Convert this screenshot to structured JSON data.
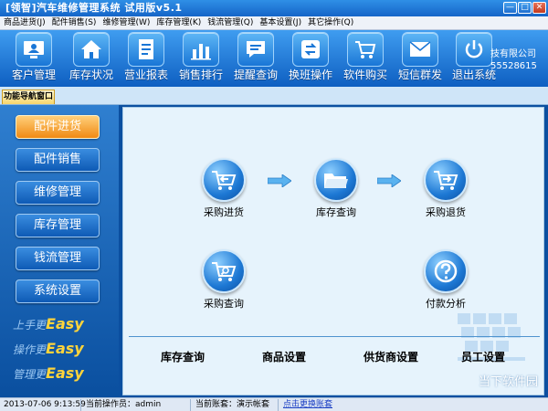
{
  "window": {
    "title": "[领智]汽车维修管理系统 试用版v5.1",
    "controls": [
      "minimize-icon",
      "maximize-icon",
      "close-icon"
    ]
  },
  "menu": [
    "商品进货(J)",
    "配件销售(S)",
    "维修管理(W)",
    "库存管理(K)",
    "钱流管理(Q)",
    "基本设置(J)",
    "其它操作(Q)"
  ],
  "toolbar": {
    "items": [
      {
        "label": "客户管理",
        "icon": "customer-icon"
      },
      {
        "label": "库存状况",
        "icon": "home-icon"
      },
      {
        "label": "营业报表",
        "icon": "report-icon"
      },
      {
        "label": "销售排行",
        "icon": "bar-chart-icon"
      },
      {
        "label": "提醒查询",
        "icon": "message-icon"
      },
      {
        "label": "换班操作",
        "icon": "shift-icon"
      },
      {
        "label": "软件购买",
        "icon": "cart-icon"
      },
      {
        "label": "短信群发",
        "icon": "mail-icon"
      },
      {
        "label": "退出系统",
        "icon": "power-icon"
      }
    ],
    "company_line1": "技有限公司",
    "company_line2": "55528615"
  },
  "nav": {
    "tab": "功能导航窗口",
    "items": [
      "配件进货",
      "配件销售",
      "维修管理",
      "库存管理",
      "钱流管理",
      "系统设置"
    ],
    "active_index": 0,
    "slogans": [
      {
        "prefix": "上手更",
        "word": "Easy"
      },
      {
        "prefix": "操作更",
        "word": "Easy"
      },
      {
        "prefix": "管理更",
        "word": "Easy"
      }
    ]
  },
  "main": {
    "actions": [
      {
        "label": "采购进货",
        "icon": "cart-return-icon"
      },
      {
        "label": "库存查询",
        "icon": "folder-icon"
      },
      {
        "label": "采购退货",
        "icon": "cart-export-icon"
      },
      {
        "label": "采购查询",
        "icon": "cart-search-icon"
      },
      {
        "label": "付款分析",
        "icon": "help-icon"
      }
    ],
    "links": [
      "库存查询",
      "商品设置",
      "供货商设置",
      "员工设置"
    ],
    "watermark": "当下软件园"
  },
  "status": {
    "datetime": "2013-07-06 9:13:59",
    "operator": "当前操作员：admin",
    "account": "当前账套：演示帐套",
    "switch": "点击更换账套"
  },
  "colors": {
    "toolbar": "#1a6fd0",
    "sidebar": "#0a4f9f",
    "active_nav": "#f08a14",
    "panel": "#e6f3fc"
  }
}
